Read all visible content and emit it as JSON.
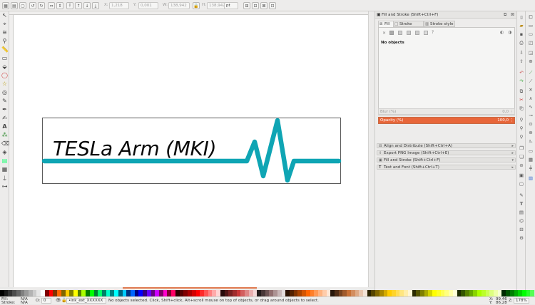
{
  "toolbar": {
    "x_label": "X:",
    "x_value": "1,218",
    "y_label": "Y:",
    "y_value": "0,001",
    "w_label": "W:",
    "w_value": "138,942",
    "h_label": "H:",
    "h_value": "138,942",
    "unit": "pt"
  },
  "canvas": {
    "logo_text": "TESLa Arm (MKI)",
    "accent_color": "#0fa5b4"
  },
  "dock": {
    "title": "Fill and Stroke (Shift+Ctrl+F)",
    "tabs": [
      "Fill",
      "Stroke paint",
      "Stroke style"
    ],
    "fill_message": "No objects",
    "blur_label": "Blur (%)",
    "blur_value": "0,0",
    "opacity_label": "Opacity (%)",
    "opacity_value": "100,0",
    "collapsed_dialogs": [
      "Align and Distribute (Shift+Ctrl+A)",
      "Export PNG Image (Shift+Ctrl+E)",
      "Fill and Stroke (Shift+Ctrl+F)",
      "Text and Font (Shift+Ctrl+T)"
    ]
  },
  "status": {
    "fill_label": "Fill:",
    "fill_value": "N/A",
    "stroke_label": "Stroke:",
    "stroke_value": "N/A",
    "opacity_label": "O:",
    "opacity_value": "0",
    "layer": "•ink_ext_XXXXXX",
    "message": "No objects selected. Click, Shift+click, Alt+scroll mouse on top of objects, or drag around objects to select.",
    "x_label": "X:",
    "x_value": "99,46",
    "y_label": "Y:",
    "y_value": "86,28",
    "zoom_label": "Z:",
    "zoom_value": "178%"
  },
  "colors": {
    "accent": "#e8663a",
    "palette": [
      "#000000",
      "#1a1a1a",
      "#333333",
      "#4d4d4d",
      "#666666",
      "#808080",
      "#999999",
      "#b3b3b3",
      "#cccccc",
      "#e6e6e6",
      "#ffffff",
      "#800000",
      "#ff0000",
      "#803300",
      "#ff6600",
      "#806600",
      "#ffcc00",
      "#808000",
      "#ffff00",
      "#558000",
      "#aaff00",
      "#008000",
      "#00ff00",
      "#008033",
      "#00ff66",
      "#008066",
      "#00ffcc",
      "#008080",
      "#00ffff",
      "#006680",
      "#00ccff",
      "#003380",
      "#0066ff",
      "#000080",
      "#0000ff",
      "#330080",
      "#6600ff",
      "#660080",
      "#cc00ff",
      "#800066",
      "#ff00cc",
      "#800033",
      "#ff0066",
      "#2b0000",
      "#550000",
      "#800000",
      "#aa0000",
      "#d40000",
      "#ff0000",
      "#ff2a2a",
      "#ff5555",
      "#ff8080",
      "#ffaaaa",
      "#ffd5d5",
      "#280b0b",
      "#501616",
      "#782121",
      "#a02c2c",
      "#c83737",
      "#d35f5f",
      "#de8787",
      "#e9afaf",
      "#f4d7d7",
      "#241c1c",
      "#483737",
      "#6c5353",
      "#916f6f",
      "#ac9393",
      "#c8b7b7",
      "#e3dbdb",
      "#2b1100",
      "#552200",
      "#803300",
      "#aa4400",
      "#d45500",
      "#ff6600",
      "#ff7f2a",
      "#ff9955",
      "#ffb380",
      "#ffccaa",
      "#ffe6d5",
      "#28170b",
      "#502d16",
      "#784421",
      "#a05a2c",
      "#c87137",
      "#d38d5f",
      "#deaa87",
      "#e9c6af",
      "#f4e3d7",
      "#2b2200",
      "#554400",
      "#806600",
      "#aa8800",
      "#d4aa00",
      "#ffcc00",
      "#ffd42a",
      "#ffdd55",
      "#ffe680",
      "#ffeeaa",
      "#fff6d5",
      "#2b2b00",
      "#555500",
      "#808000",
      "#aaaa00",
      "#d4d400",
      "#ffff00",
      "#ffff2a",
      "#ffff55",
      "#ffff80",
      "#ffffaa",
      "#ffffd5",
      "#1c2b00",
      "#335500",
      "#558000",
      "#66aa00",
      "#88d400",
      "#aaff00",
      "#bbff2a",
      "#ccff55",
      "#ddff80",
      "#eeffaa",
      "#f6ffd5",
      "#002b00",
      "#005500",
      "#008000",
      "#00aa00",
      "#00d400",
      "#00ff00",
      "#2aff2a",
      "#55ff55"
    ]
  },
  "icons": {
    "tools": [
      "select-arrow-icon",
      "node-icon",
      "tweak-icon",
      "zoom-icon",
      "measure-icon",
      "rect-icon",
      "box3d-icon",
      "ellipse-icon",
      "star-icon",
      "spiral-icon",
      "pencil-icon",
      "pen-icon",
      "calligraphy-icon",
      "text-icon",
      "spray-icon",
      "eraser-icon",
      "bucket-icon",
      "gradient-icon",
      "mesh-icon",
      "dropper-icon",
      "connector-icon"
    ]
  }
}
